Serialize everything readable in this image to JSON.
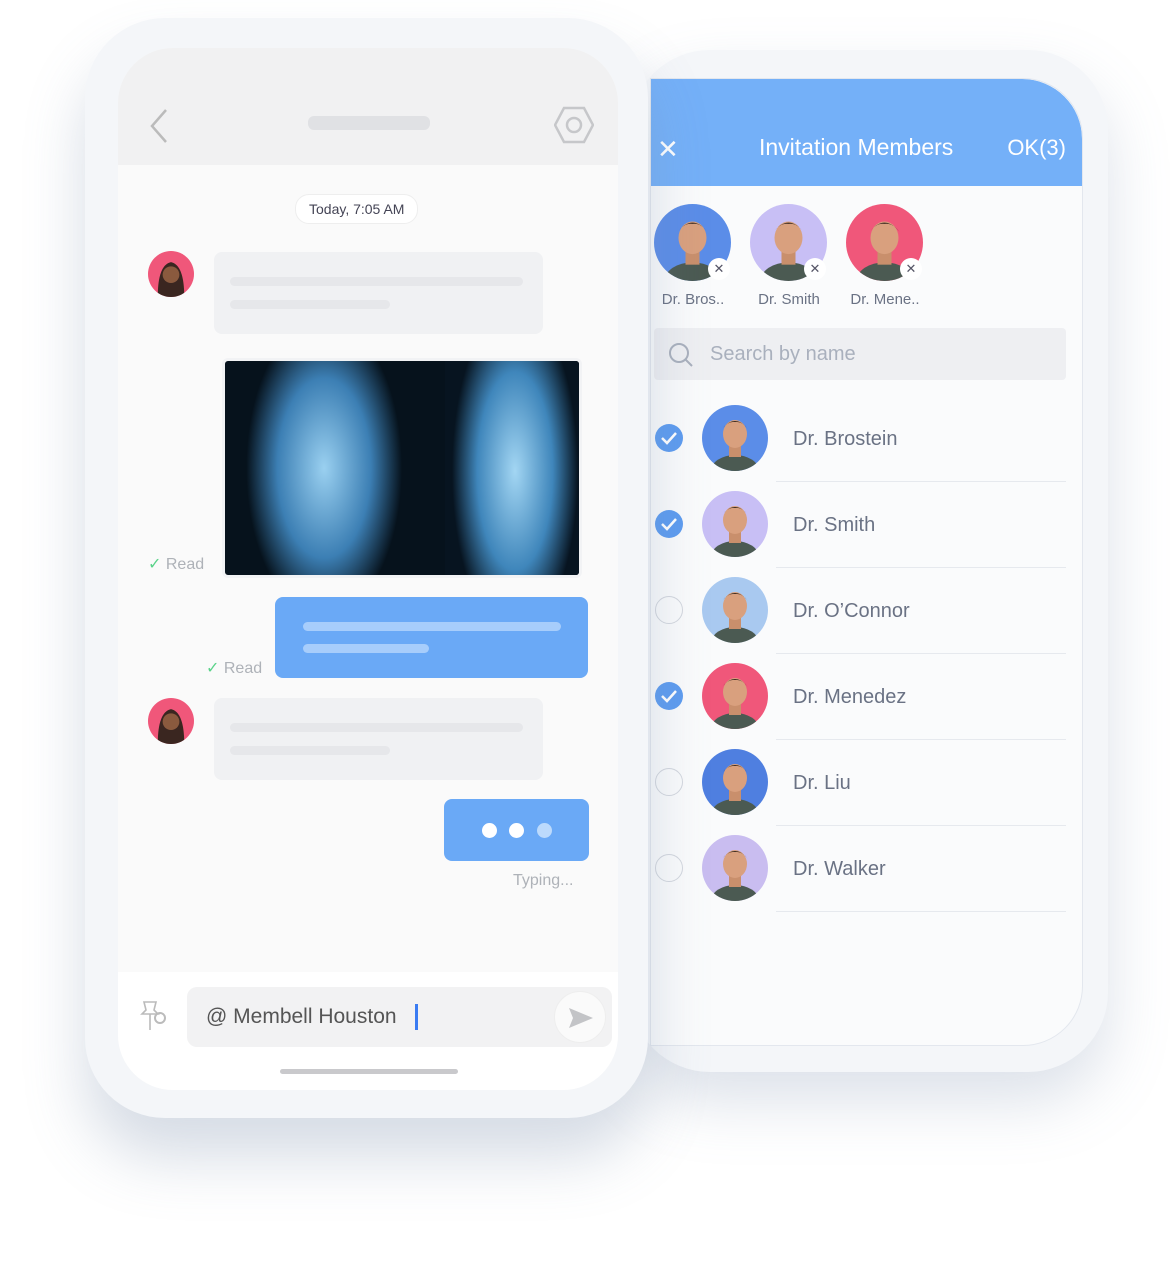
{
  "invite": {
    "title": "Invitation Members",
    "ok_label": "OK(3)",
    "close_icon": "close-icon",
    "selected": [
      {
        "name": "Dr. Bros..",
        "color": "#5b8de8"
      },
      {
        "name": "Dr. Smith",
        "color": "#c8bff5"
      },
      {
        "name": "Dr. Mene..",
        "color": "#f0577a"
      }
    ],
    "search_placeholder": "Search by name",
    "members": [
      {
        "name": "Dr. Brostein",
        "checked": true,
        "color": "#5b8de8"
      },
      {
        "name": "Dr. Smith",
        "checked": true,
        "color": "#c8bff5"
      },
      {
        "name": "Dr. O’Connor",
        "checked": false,
        "color": "#a9c9f0"
      },
      {
        "name": "Dr. Menedez",
        "checked": true,
        "color": "#f0577a"
      },
      {
        "name": "Dr. Liu",
        "checked": false,
        "color": "#4f7fe0"
      },
      {
        "name": "Dr. Walker",
        "checked": false,
        "color": "#c9bdf0"
      }
    ]
  },
  "chat": {
    "timestamp": "Today, 7:05 AM",
    "read_label": "Read",
    "typing_label": "Typing...",
    "input_value": "@ Membell Houston",
    "accent": "#6aa9f6"
  }
}
